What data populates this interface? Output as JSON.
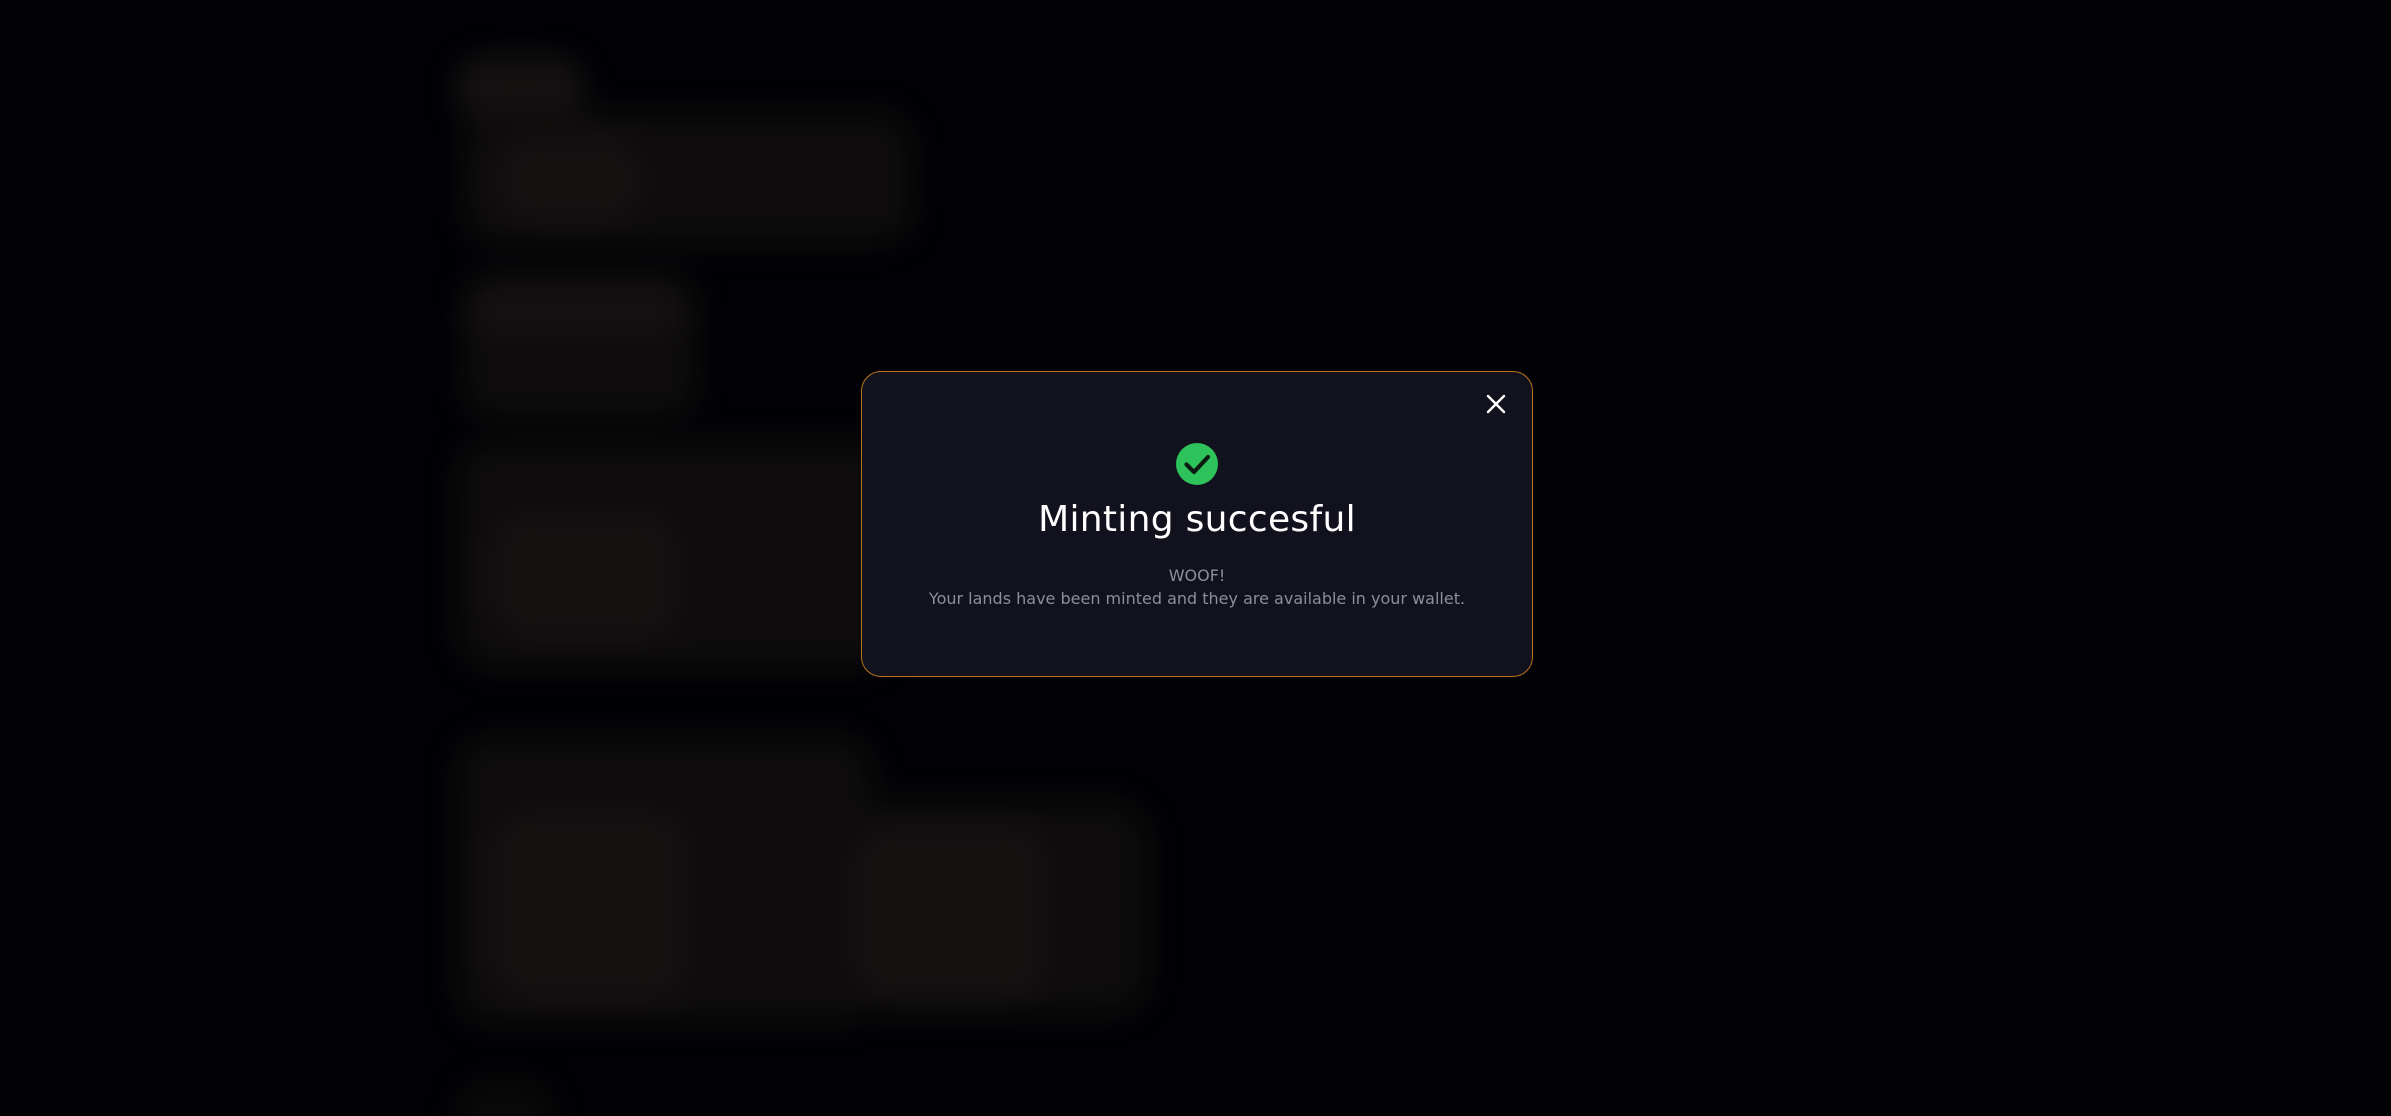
{
  "modal": {
    "close_icon": "close-icon",
    "status_icon": "check-circle-icon",
    "status_color": "#2ec35a",
    "border_color": "#b8721f",
    "title": "Minting succesful",
    "message_line1": "WOOF!",
    "message_line2": "Your lands have been minted and they are available in your wallet."
  }
}
